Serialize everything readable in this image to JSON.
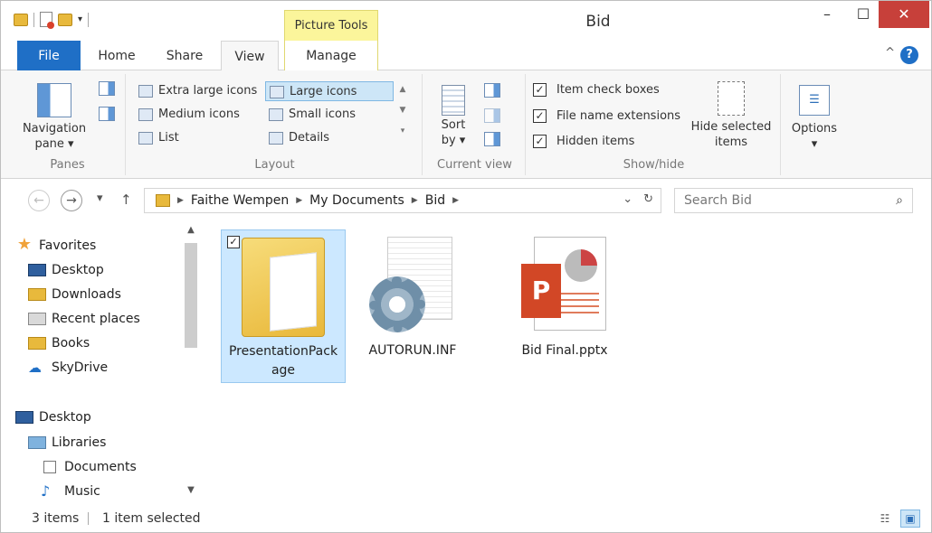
{
  "window": {
    "title": "Bid"
  },
  "quick_access": {
    "arrow": "▾"
  },
  "context_tab": {
    "header": "Picture Tools"
  },
  "tabs": {
    "file": "File",
    "home": "Home",
    "share": "Share",
    "view": "View",
    "manage": "Manage"
  },
  "ribbon": {
    "panes": {
      "nav_pane_label": "Navigation pane ▾",
      "group_label": "Panes"
    },
    "layout": {
      "items": [
        "Extra large icons",
        "Large icons",
        "Medium icons",
        "Small icons",
        "List",
        "Details"
      ],
      "selected": "Large icons",
      "group_label": "Layout"
    },
    "current_view": {
      "sort_label": "Sort by ▾",
      "group_label": "Current view"
    },
    "show_hide": {
      "item_check_boxes": "Item check boxes",
      "file_name_extensions": "File name extensions",
      "hidden_items": "Hidden items",
      "hide_selected": "Hide selected items",
      "group_label": "Show/hide"
    },
    "options": {
      "label": "Options",
      "arrow": "▾"
    }
  },
  "address": {
    "crumbs": [
      "Faithe Wempen",
      "My Documents",
      "Bid"
    ],
    "search_placeholder": "Search Bid"
  },
  "nav_pane": {
    "favorites_header": "Favorites",
    "favorites": [
      "Desktop",
      "Downloads",
      "Recent places",
      "Books",
      "SkyDrive"
    ],
    "desktop_header": "Desktop",
    "libraries": "Libraries",
    "library_items": [
      "Documents",
      "Music"
    ]
  },
  "files": [
    {
      "name": "PresentationPack age",
      "selected": true
    },
    {
      "name": "AUTORUN.INF",
      "selected": false
    },
    {
      "name": "Bid Final.pptx",
      "selected": false
    }
  ],
  "ppt_badge": "P",
  "status": {
    "items": "3 items",
    "selected": "1 item selected"
  }
}
